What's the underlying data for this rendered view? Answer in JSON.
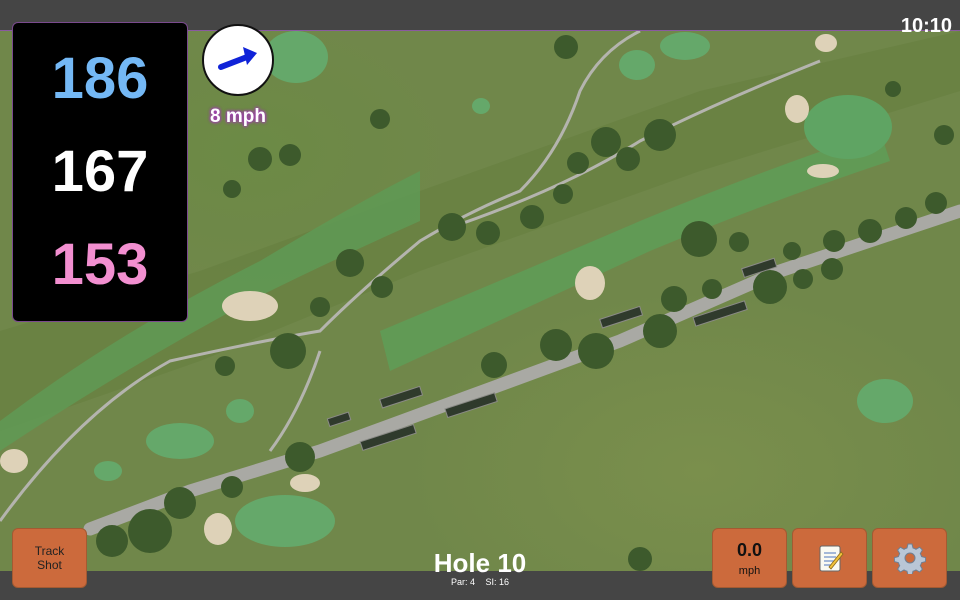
{
  "status": {
    "time": "10:10"
  },
  "distances": {
    "back": "186",
    "middle": "167",
    "front": "153",
    "colors": {
      "back": "#74b8f5",
      "middle": "#ffffff",
      "front": "#f28fd0"
    }
  },
  "wind": {
    "speed_label": "8 mph",
    "icon": "wind-direction-arrow-icon",
    "arrow_color": "#1023d8"
  },
  "buttons": {
    "track_shot_line1": "Track",
    "track_shot_line2": "Shot",
    "speed_value": "0.0",
    "speed_unit": "mph",
    "notes_icon": "notepad-icon",
    "settings_icon": "gear-icon",
    "accent": "#cc6a3c"
  },
  "hole": {
    "title": "Hole 10",
    "par": "Par: 4",
    "si": "SI: 16"
  },
  "map": {
    "type": "satellite-golf-course",
    "fairway_color": "#5e9a52",
    "path_color": "#b4b4b0"
  }
}
